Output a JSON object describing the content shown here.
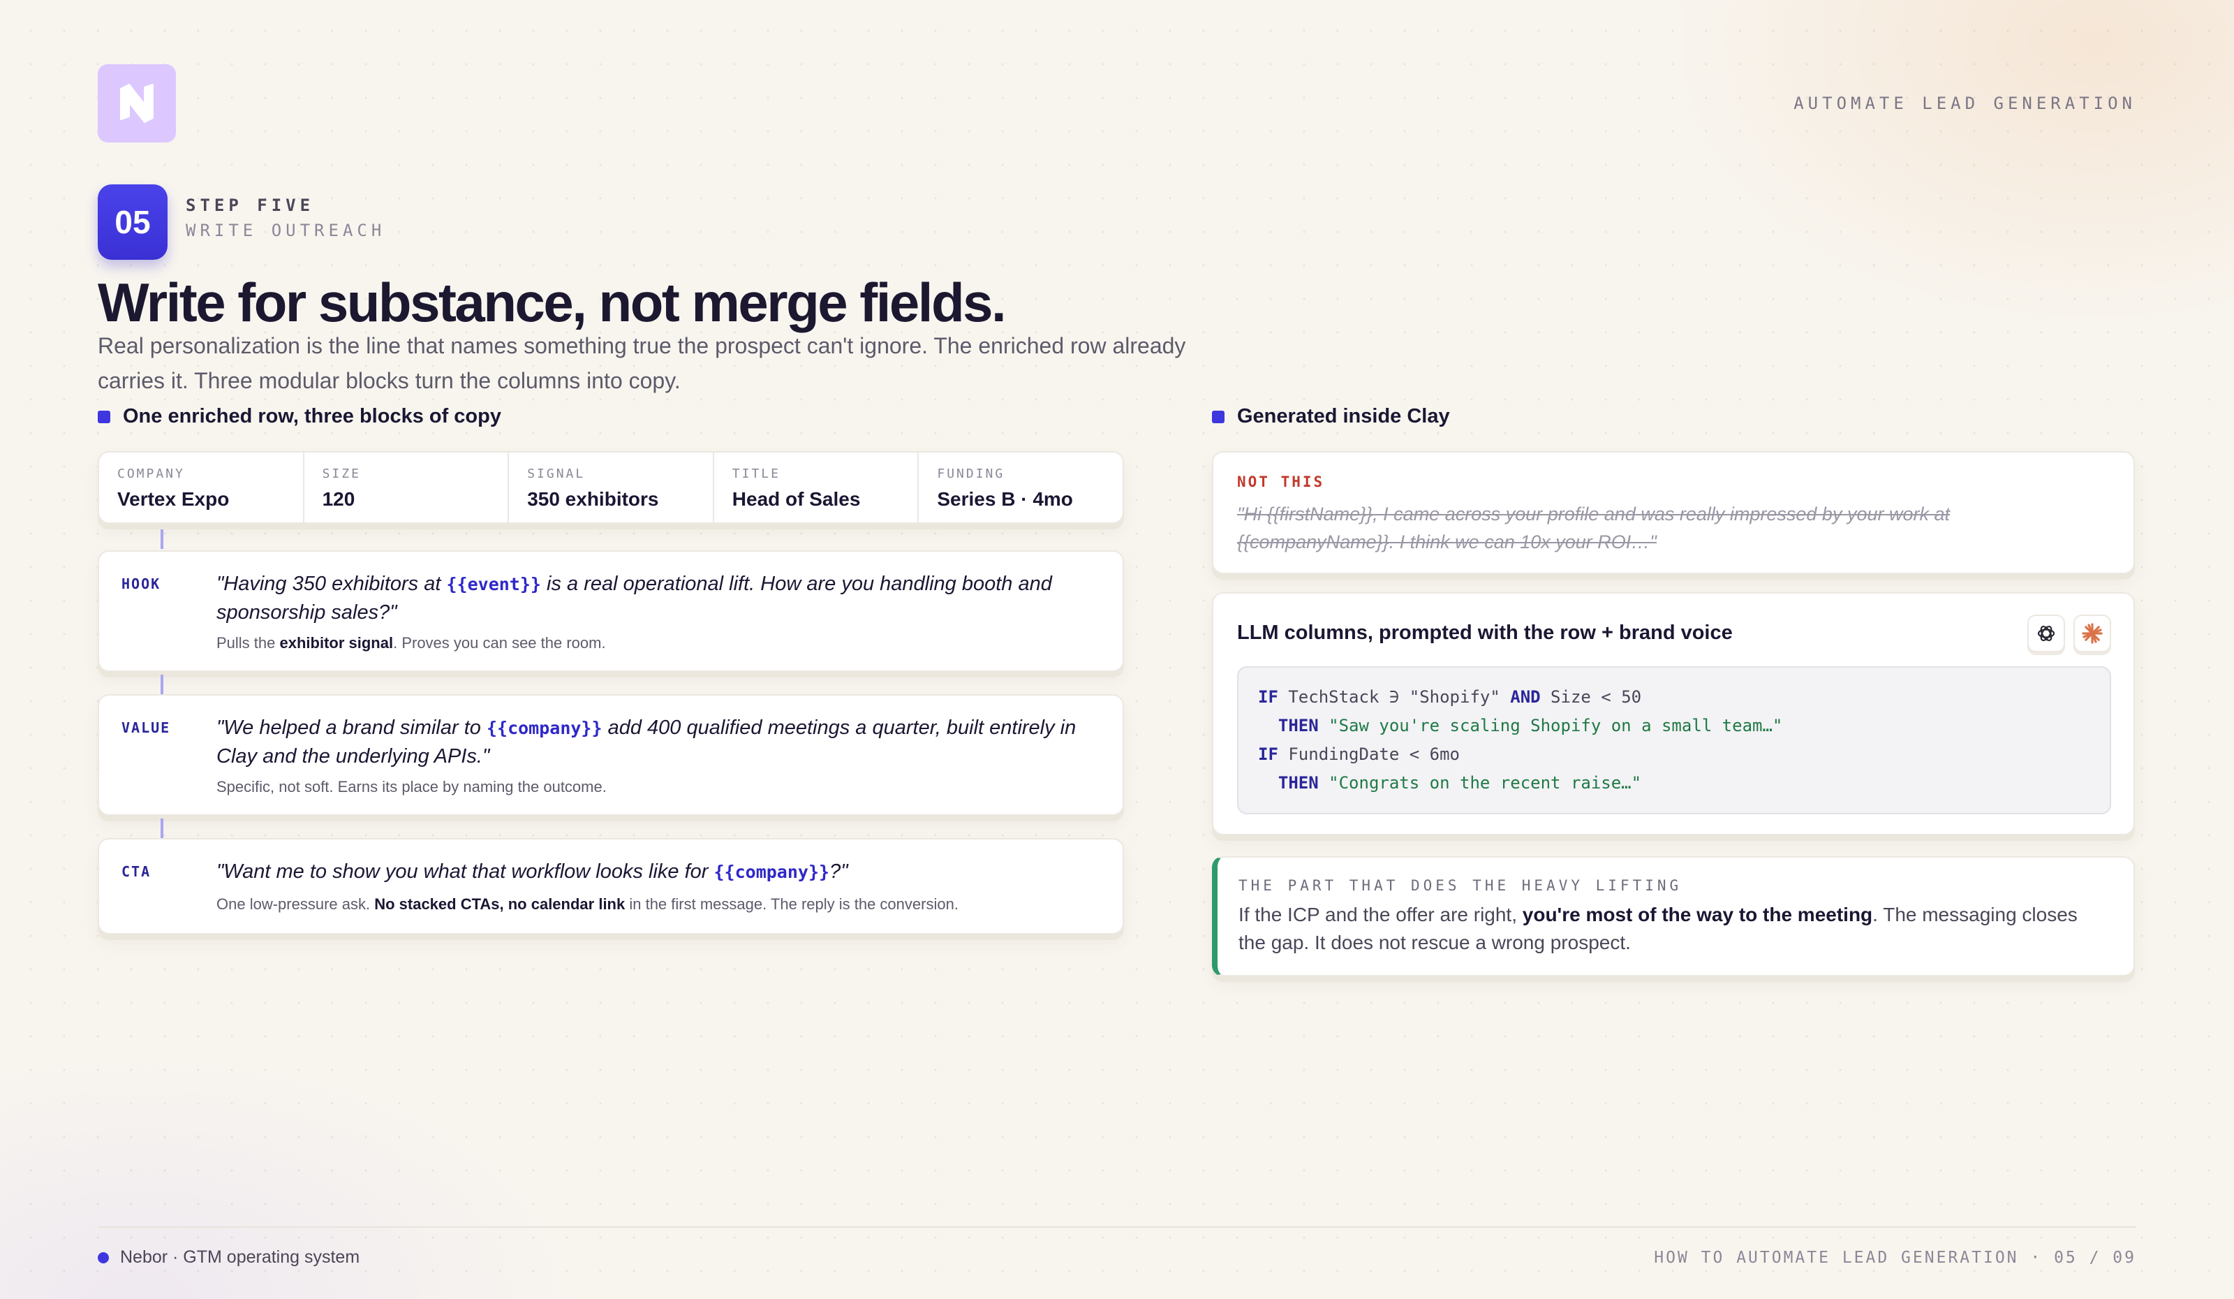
{
  "header": {
    "logo_icon": "nebor-logo-icon",
    "top_right": "AUTOMATE LEAD GENERATION"
  },
  "step": {
    "number": "05",
    "kicker": "STEP FIVE",
    "subtitle": "WRITE OUTREACH"
  },
  "title": "Write for substance, not merge fields.",
  "lede": "Real personalization is the line that names something true the prospect can't ignore. The enriched row already carries it. Three modular blocks turn the columns into copy.",
  "left": {
    "section_label": "One enriched row, three blocks of copy",
    "row": [
      {
        "key": "COMPANY",
        "value": "Vertex Expo"
      },
      {
        "key": "SIZE",
        "value": "120"
      },
      {
        "key": "SIGNAL",
        "value": "350 exhibitors"
      },
      {
        "key": "TITLE",
        "value": "Head of Sales"
      },
      {
        "key": "FUNDING",
        "value": "Series B · 4mo"
      }
    ],
    "blocks": {
      "hook": {
        "tag": "HOOK",
        "quote_pre": "\"Having 350 exhibitors at ",
        "quote_var": "{{event}}",
        "quote_post": " is a real operational lift. How are you handling booth and sponsorship sales?\"",
        "note_pre": "Pulls the ",
        "note_bold": "exhibitor signal",
        "note_post": ". Proves you can see the room."
      },
      "value": {
        "tag": "VALUE",
        "quote_pre": "\"We helped a brand similar to ",
        "quote_var": "{{company}}",
        "quote_post": " add 400 qualified meetings a quarter, built entirely in Clay and the underlying APIs.\"",
        "note": "Specific, not soft. Earns its place by naming the outcome."
      },
      "cta": {
        "tag": "CTA",
        "quote_pre": "\"Want me to show you what that workflow looks like for ",
        "quote_var": "{{company}}",
        "quote_post": "?\"",
        "note_pre": "One low-pressure ask. ",
        "note_bold": "No stacked CTAs, no calendar link",
        "note_post": " in the first message. The reply is the conversion."
      }
    }
  },
  "right": {
    "section_label": "Generated inside Clay",
    "not_this": {
      "label": "NOT THIS",
      "text": "\"Hi {{firstName}}, I came across your profile and was really impressed by your work at {{companyName}}. I think we can 10x your ROI…\""
    },
    "llm": {
      "title": "LLM columns, prompted with the row + brand voice",
      "icons": [
        "openai-icon",
        "claude-icon"
      ],
      "code": {
        "l1_kw1": "IF",
        "l1_body": " TechStack ∋ \"Shopify\" ",
        "l1_kw2": "AND",
        "l1_tail": " Size < 50",
        "l2_kw": "THEN",
        "l2_str": "\"Saw you're scaling Shopify on a small team…\"",
        "l3_kw": "IF",
        "l3_body": " FundingDate < 6mo",
        "l4_kw": "THEN",
        "l4_str": "\"Congrats on the recent raise…\""
      }
    },
    "heavy": {
      "label": "THE PART THAT DOES THE HEAVY LIFTING",
      "text_pre": "If the ICP and the offer are right, ",
      "text_bold": "you're most of the way to the meeting",
      "text_post": ". The messaging closes the gap. It does not rescue a wrong prospect."
    }
  },
  "footer": {
    "left": "Nebor · GTM operating system",
    "right": "HOW TO AUTOMATE LEAD GENERATION · 05 / 09"
  },
  "colors": {
    "accent": "#3e37e0",
    "danger": "#c0392b",
    "success": "#2e9a6b",
    "logo_bg": "#dcc7ff"
  }
}
